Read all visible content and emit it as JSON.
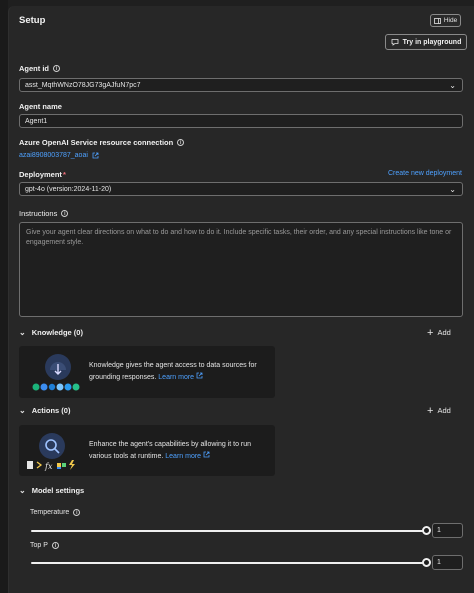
{
  "header": {
    "title": "Setup",
    "hide_label": "Hide",
    "try_label": "Try in playground"
  },
  "agent_id": {
    "label": "Agent id",
    "value": "asst_MqthWNzO78JG73gAJfuN7pc7"
  },
  "agent_name": {
    "label": "Agent name",
    "value": "Agent1"
  },
  "connection": {
    "label": "Azure OpenAI Service resource connection",
    "value": "azai8908003787_aoai"
  },
  "deployment": {
    "label": "Deployment",
    "required_mark": "*",
    "create_link": "Create new deployment",
    "value": "gpt-4o (version:2024-11-20)"
  },
  "instructions": {
    "label": "Instructions",
    "placeholder": "Give your agent clear directions on what to do and how to do it. Include specific tasks, their order, and any special instructions like tone or engagement style."
  },
  "knowledge": {
    "title": "Knowledge (0)",
    "add_label": "Add",
    "card_text": "Knowledge gives the agent access to data sources for grounding responses.",
    "learn_more": "Learn more"
  },
  "actions": {
    "title": "Actions (0)",
    "add_label": "Add",
    "card_text": "Enhance the agent's capabilities by allowing it to run various tools at runtime.",
    "learn_more": "Learn more"
  },
  "model_settings": {
    "title": "Model settings",
    "temperature": {
      "label": "Temperature",
      "value": "1",
      "level": 1.0
    },
    "top_p": {
      "label": "Top P",
      "value": "1",
      "level": 1.0
    }
  },
  "colors": {
    "accent_link": "#4ea1ff",
    "background": "#272727",
    "field_bg": "#1f1f1f"
  }
}
